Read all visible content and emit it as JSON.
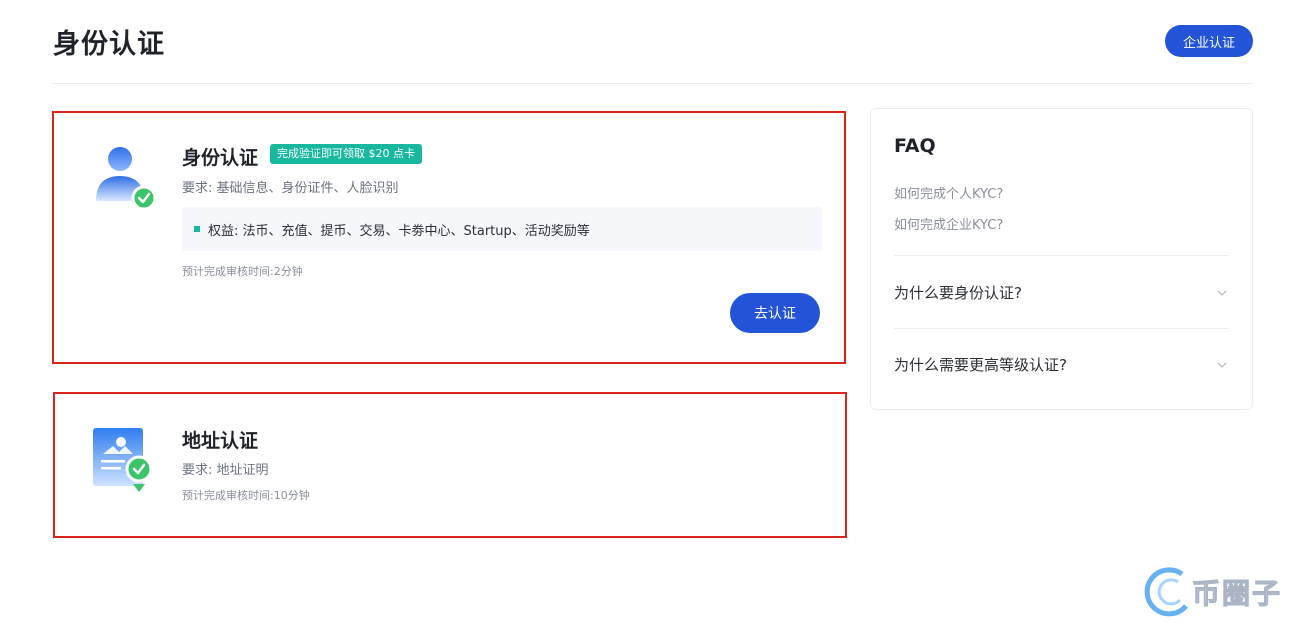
{
  "header": {
    "title": "身份认证",
    "enterprise_button": "企业认证"
  },
  "identity_card": {
    "title": "身份认证",
    "promo_badge": "完成验证即可领取 $20 点卡",
    "requirement": "要求: 基础信息、身份证件、人脸识别",
    "benefits": "权益: 法币、充值、提币、交易、卡劵中心、Startup、活动奖励等",
    "eta": "预计完成审核时间:2分钟",
    "button": "去认证",
    "icon": "user-verified-icon"
  },
  "address_card": {
    "title": "地址认证",
    "requirement": "要求: 地址证明",
    "eta": "预计完成审核时间:10分钟",
    "icon": "address-document-verified-icon"
  },
  "faq": {
    "title": "FAQ",
    "links": [
      "如何完成个人KYC?",
      "如何完成企业KYC?"
    ],
    "questions": [
      "为什么要身份认证?",
      "为什么需要更高等级认证?"
    ]
  },
  "watermark": {
    "text": "币圈子"
  },
  "colors": {
    "primary": "#2354d8",
    "accent_green": "#18b89f",
    "highlight_border": "#d9251c"
  }
}
